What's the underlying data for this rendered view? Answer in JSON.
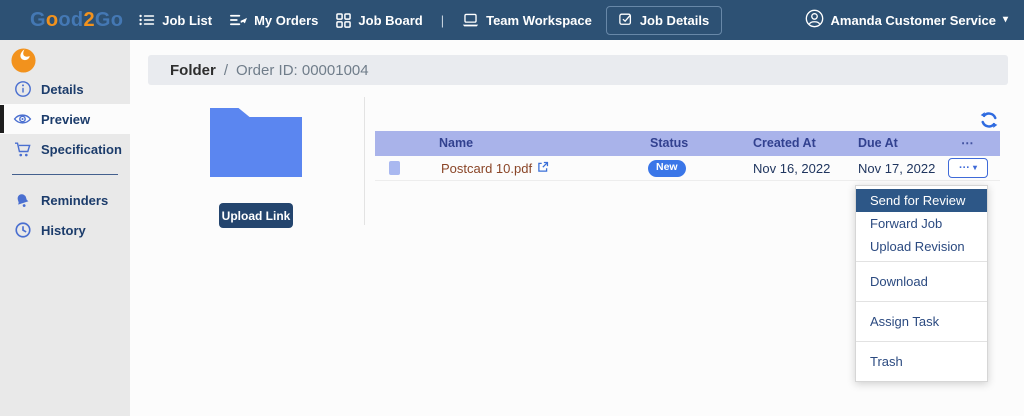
{
  "colors": {
    "navbar_bg": "#2d5174",
    "logo_blue": "#4478b4",
    "logo_orange": "#f2921d",
    "sidebar_bg": "#e9e9e9",
    "sidebar_icon_blue": "#4a6fd0",
    "table_header_bg": "#a9b3ea",
    "status_badge_blue": "#3a76e8",
    "file_link_brown": "#8a4527",
    "folder_blue": "#5b86f0",
    "upload_button_navy": "#24456e",
    "menu_active_bg": "#2d5787"
  },
  "navbar": {
    "logo_segments": [
      "G",
      "o",
      "od",
      "2",
      "Go"
    ],
    "items": [
      "Job List",
      "My Orders",
      "Job Board",
      "Team Workspace"
    ],
    "separator": "|",
    "job_details_label": "Job Details",
    "user_name": "Amanda Customer Service",
    "user_caret": "▾"
  },
  "sidebar": {
    "items": [
      "Details",
      "Preview",
      "Specification",
      "Reminders",
      "History"
    ]
  },
  "breadcrumb": {
    "root": "Folder",
    "separator": "/",
    "current": "Order ID: 00001004"
  },
  "folder_panel": {
    "upload_link_label": "Upload Link"
  },
  "table": {
    "headers": {
      "name": "Name",
      "status": "Status",
      "created": "Created At",
      "due": "Due At",
      "actions": "⋯"
    },
    "row": {
      "name": "Postcard 10.pdf",
      "status": "New",
      "created": "Nov 16, 2022",
      "due": "Nov 17, 2022"
    },
    "actions_button": "···",
    "actions_caret": "▾"
  },
  "context_menu": {
    "items": [
      "Send for Review",
      "Forward Job",
      "Upload Revision",
      "Download",
      "Assign Task",
      "Trash"
    ]
  }
}
